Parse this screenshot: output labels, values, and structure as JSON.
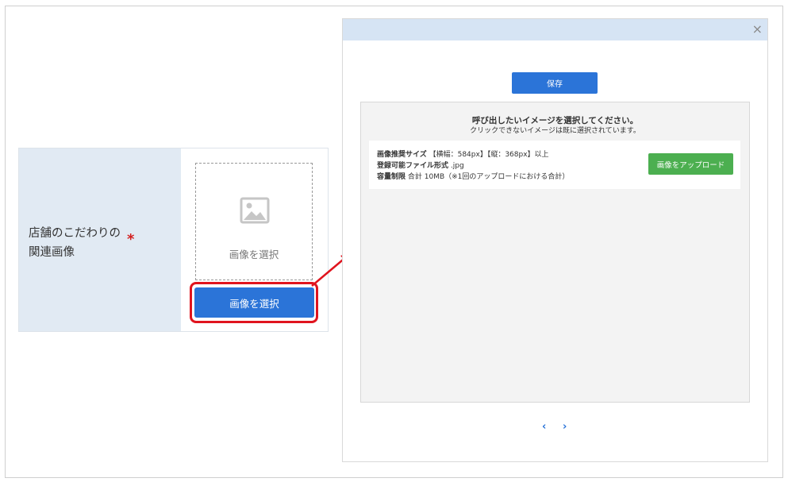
{
  "form": {
    "label_line1": "店舗のこだわりの",
    "label_line2": "関連画像",
    "required_mark": "*",
    "image_placeholder_label": "画像を選択",
    "select_button_label": "画像を選択"
  },
  "modal": {
    "close_label": "×",
    "save_button_label": "保存",
    "panel_title": "呼び出したいイメージを選択してください。",
    "panel_subtitle": "クリックできないイメージは既に選択されています。",
    "info": {
      "size_label": "画像推奨サイズ",
      "size_value": "【横幅：584px】【縦：368px】以上",
      "format_label": "登録可能ファイル形式",
      "format_value": ".jpg",
      "limit_label": "容量制限",
      "limit_value": "合計 10MB（※1回のアップロードにおける合計）"
    },
    "upload_button_label": "画像をアップロード",
    "pager_prev": "‹",
    "pager_next": "›"
  },
  "colors": {
    "primary": "#2b74d8",
    "success": "#4caf50",
    "highlight": "#e0141e",
    "label_bg": "#e1eaf3",
    "modal_header_bg": "#d6e4f4"
  },
  "icons": [
    "image-icon",
    "close-icon",
    "arrow-icon",
    "chevron-left-icon",
    "chevron-right-icon"
  ]
}
